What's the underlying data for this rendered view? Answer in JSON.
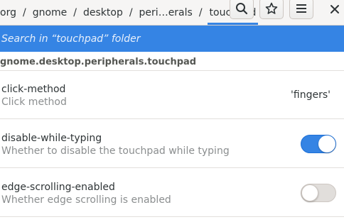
{
  "breadcrumb": {
    "items": [
      "org",
      "gnome",
      "desktop",
      "peri…erals",
      "touchpad"
    ],
    "separator": "/",
    "active_index": 4
  },
  "header": {
    "buttons": [
      {
        "icon": "search-icon"
      },
      {
        "icon": "star-icon"
      },
      {
        "icon": "hamburger-menu-icon"
      }
    ],
    "close_icon": "close-icon"
  },
  "search": {
    "placeholder": "Search in “touchpad” folder"
  },
  "path_title": "gnome.desktop.peripherals.touchpad",
  "keys": [
    {
      "name": "click-method",
      "description": "Click method",
      "value": "'fingers'"
    },
    {
      "name": "disable-while-typing",
      "description": "Whether to disable the touchpad while typing",
      "toggle": true
    },
    {
      "name": "edge-scrolling-enabled",
      "description": "Whether edge scrolling is enabled",
      "toggle": false
    }
  ],
  "colors": {
    "accent": "#3584e4",
    "header_bg": "#f6f5f4",
    "secondary_text": "#8b8e8f"
  }
}
